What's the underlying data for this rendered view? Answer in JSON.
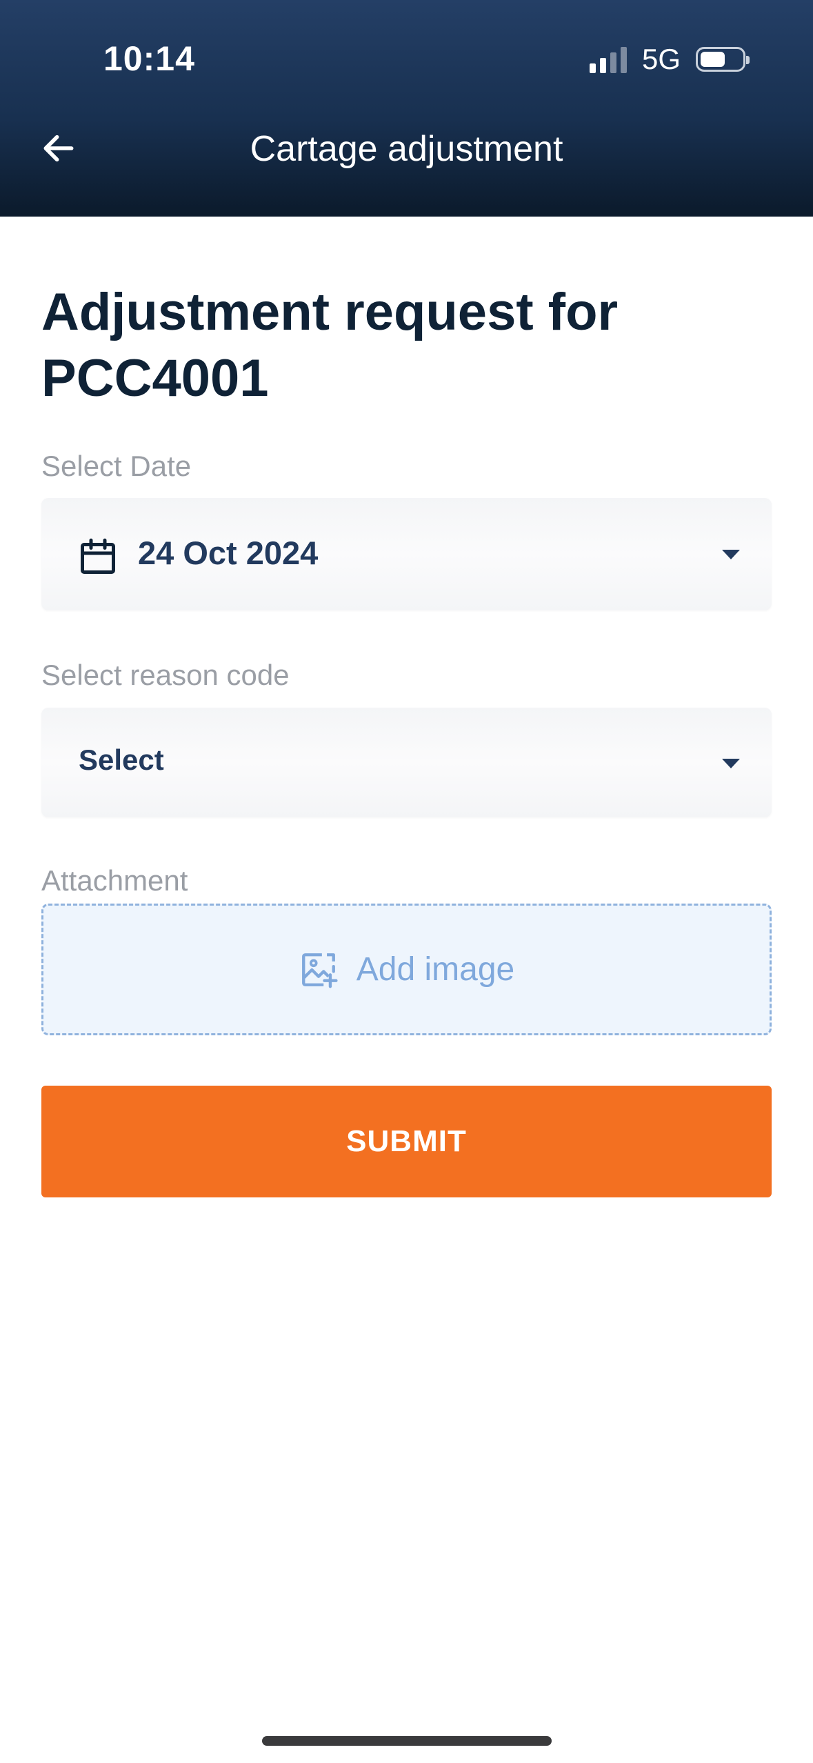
{
  "status_bar": {
    "time": "10:14",
    "network": "5G",
    "signal_bars_active": 2,
    "signal_bars_total": 4,
    "battery_level": 0.6
  },
  "header": {
    "title": "Cartage adjustment",
    "back_icon": "arrow-left-icon"
  },
  "form": {
    "title": "Adjustment request for PCC4001",
    "date": {
      "label": "Select Date",
      "value": "24 Oct 2024",
      "icon": "calendar-icon"
    },
    "reason": {
      "label": "Select reason code",
      "value": "Select"
    },
    "attachment": {
      "label": "Attachment",
      "button_label": "Add image",
      "icon": "add-image-icon"
    },
    "submit_label": "SUBMIT"
  },
  "colors": {
    "header_top": "#243f66",
    "header_bottom": "#0b1a2b",
    "primary_text": "#0f2236",
    "value_text": "#223a5e",
    "label_text": "#9a9ea5",
    "accent": "#f37021",
    "attach_border": "#8fb2dd",
    "attach_bg": "#eef5fd"
  }
}
